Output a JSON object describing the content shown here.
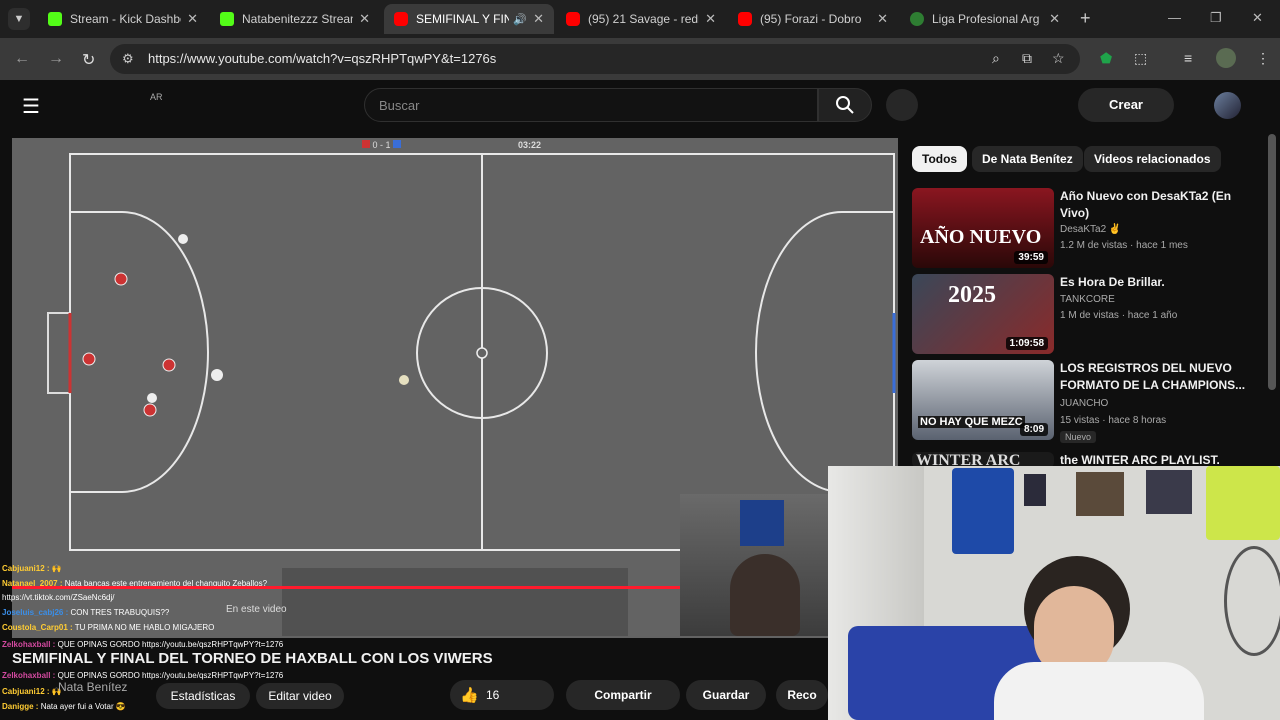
{
  "browser": {
    "tabs": [
      {
        "title": "Stream - Kick Dashbo",
        "icon": "kick-icon"
      },
      {
        "title": "Natabenitezzz Stream",
        "icon": "kick-icon"
      },
      {
        "title": "SEMIFINAL Y FIN",
        "icon": "youtube-icon"
      },
      {
        "title": "(95) 21 Savage - redr",
        "icon": "youtube-icon"
      },
      {
        "title": "(95) Forazi - Dobro",
        "icon": "youtube-icon"
      },
      {
        "title": "Liga Profesional Arg",
        "icon": "lpf-icon"
      }
    ],
    "url": "https://www.youtube.com/watch?v=qszRHPTqwPY&t=1276s"
  },
  "header": {
    "region": "AR",
    "search_placeholder": "Buscar",
    "create_label": "Crear"
  },
  "player": {
    "score": "0 - 1",
    "timer": "03:22",
    "ctrl_label": "En este video",
    "chat": [
      {
        "user": "Cabjuani12 :",
        "text": "🙌"
      },
      {
        "user": "Natanael_2007 :",
        "text": "Nata bancas este entrenamiento del changuito Zeballos?"
      },
      {
        "user": "",
        "text": "https://vt.tiktok.com/ZSaeNc6dj/"
      },
      {
        "user": "Joseluis_cabj26 :",
        "text": "CON TRES TRABUQUIS??"
      },
      {
        "user": "Coustola_Carp01 :",
        "text": "TU PRIMA NO ME HABLO MIGAJERO"
      },
      {
        "user": "Zelkohaxball :",
        "text": "QUE OPINAS GORDO https://youtu.be/qszRHPTqwPY?t=1276"
      },
      {
        "user": "Zelkohaxball :",
        "text": "QUE OPINAS GORDO https://youtu.be/qszRHPTqwPY?t=1276"
      },
      {
        "user": "Cabjuani12 :",
        "text": "🙌"
      },
      {
        "user": "Danigge :",
        "text": "Nata ayer fui a Votar 😎"
      }
    ]
  },
  "video": {
    "title": "SEMIFINAL Y FINAL DEL TORNEO DE HAXBALL CON LOS VIWERS",
    "channel": "Nata Benítez",
    "stats_label": "Estadísticas",
    "edit_label": "Editar video",
    "likes": "16",
    "share_label": "Compartir",
    "save_label": "Guardar",
    "clip_label": "Reco"
  },
  "sidebar": {
    "chips": [
      "Todos",
      "De Nata Benítez",
      "Videos relacionados"
    ],
    "recommendations": [
      {
        "title": "Año Nuevo con DesaKTa2 (En Vivo)",
        "channel": "DesaKTa2 ✌",
        "meta": "1.2 M de vistas · hace 1 mes",
        "duration": "39:59",
        "thumb_text": "AÑO NUEVO"
      },
      {
        "title": "Es Hora De Brillar.",
        "channel": "TANKCORE",
        "meta": "1 M de vistas · hace 1 año",
        "duration": "1:09:58",
        "thumb_text": "2025"
      },
      {
        "title": "LOS REGISTROS DEL NUEVO FORMATO DE LA CHAMPIONS...",
        "channel": "JUANCHO",
        "meta": "15 vistas · hace 8 horas",
        "duration": "8:09",
        "thumb_text": "NO HAY QUE MEZC",
        "badge": "Nuevo"
      },
      {
        "title": "the WINTER ARC PLAYLIST.",
        "thumb_text": "WINTER ARC"
      }
    ]
  }
}
